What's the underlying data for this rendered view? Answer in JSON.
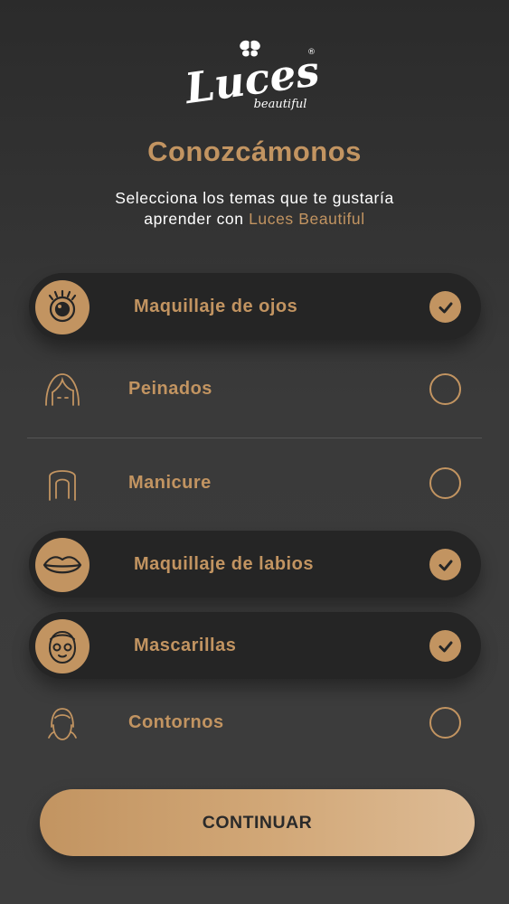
{
  "brand": {
    "logo_text": "Luces",
    "logo_subtext": "beautiful",
    "logo_mark": "®"
  },
  "header": {
    "title": "Conozcámonos",
    "subtitle_line1": "Selecciona los temas que te gustaría",
    "subtitle_line2_prefix": "aprender con ",
    "subtitle_line2_brand": "Luces Beautiful"
  },
  "topics": [
    {
      "label": "Maquillaje de ojos",
      "icon": "eye-icon",
      "selected": true
    },
    {
      "label": "Peinados",
      "icon": "hair-icon",
      "selected": false
    },
    {
      "label": "Manicure",
      "icon": "nail-icon",
      "selected": false
    },
    {
      "label": "Maquillaje de labios",
      "icon": "lips-icon",
      "selected": true
    },
    {
      "label": "Mascarillas",
      "icon": "face-mask-icon",
      "selected": true
    },
    {
      "label": "Contornos",
      "icon": "contour-face-icon",
      "selected": false
    }
  ],
  "cta": {
    "label": "CONTINUAR"
  },
  "colors": {
    "accent": "#c29461",
    "background": "#333333",
    "selected_row": "#252525"
  }
}
